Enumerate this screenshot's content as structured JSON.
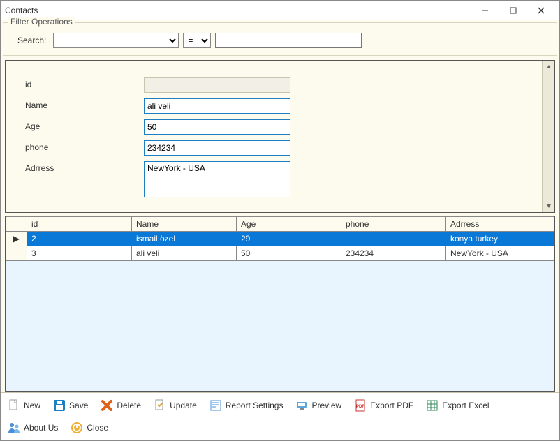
{
  "window": {
    "title": "Contacts"
  },
  "filter": {
    "legend": "Filter Operations",
    "search_label": "Search:",
    "field_value": "",
    "operator_value": "=",
    "term_value": ""
  },
  "form": {
    "fields": {
      "id": {
        "label": "id",
        "value": ""
      },
      "name": {
        "label": "Name",
        "value": "ali veli"
      },
      "age": {
        "label": "Age",
        "value": "50"
      },
      "phone": {
        "label": "phone",
        "value": "234234"
      },
      "address": {
        "label": "Adrress",
        "value": "NewYork - USA"
      }
    }
  },
  "grid": {
    "columns": [
      "id",
      "Name",
      "Age",
      "phone",
      "Adrress"
    ],
    "rows": [
      {
        "selected": true,
        "cells": [
          "2",
          "ismail özel",
          "29",
          "",
          "konya turkey"
        ]
      },
      {
        "selected": false,
        "cells": [
          "3",
          "ali veli",
          "50",
          "234234",
          "NewYork - USA"
        ]
      }
    ],
    "row_indicator": "▶"
  },
  "toolbar": {
    "new": "New",
    "save": "Save",
    "delete": "Delete",
    "update": "Update",
    "report_settings": "Report Settings",
    "preview": "Preview",
    "export_pdf": "Export PDF",
    "export_excel": "Export Excel",
    "about_us": "About Us",
    "close": "Close"
  }
}
